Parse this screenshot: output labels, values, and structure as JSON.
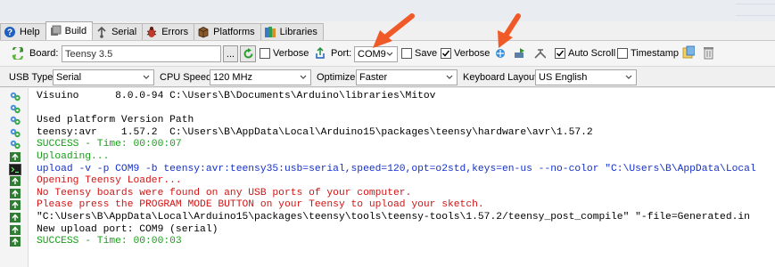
{
  "tabs": [
    {
      "label": "Help",
      "icon": "help-icon"
    },
    {
      "label": "Build",
      "icon": "build-icon"
    },
    {
      "label": "Serial",
      "icon": "serial-icon"
    },
    {
      "label": "Errors",
      "icon": "bug-icon"
    },
    {
      "label": "Platforms",
      "icon": "platforms-icon"
    },
    {
      "label": "Libraries",
      "icon": "libraries-icon"
    }
  ],
  "active_tab": "Build",
  "toolbar": {
    "board_label": "Board:",
    "board_value": "Teensy 3.5",
    "browse_label": "...",
    "verbose_label_1": "Verbose",
    "port_label": "Port:",
    "port_value": "COM9",
    "save_label": "Save",
    "verbose_label_2": "Verbose",
    "verbose_2_checked": true,
    "autoscroll_label": "Auto Scroll",
    "autoscroll_checked": true,
    "timestamp_label": "Timestamp"
  },
  "options": {
    "usb_type_label": "USB Type:",
    "usb_type_value": "Serial",
    "cpu_speed_label": "CPU Speed:",
    "cpu_speed_value": "120 MHz",
    "optimize_label": "Optimize:",
    "optimize_value": "Faster",
    "keyboard_layout_label": "Keyboard Layout:",
    "keyboard_layout_value": "US English"
  },
  "console": {
    "lines": [
      {
        "text": "Visuino      8.0.0-94 C:\\Users\\B\\Documents\\Arduino\\libraries\\Mitov",
        "color": "#000000",
        "icon": "info"
      },
      {
        "text": "",
        "color": "#000000",
        "icon": "info"
      },
      {
        "text": "Used platform Version Path",
        "color": "#000000",
        "icon": "info"
      },
      {
        "text": "teensy:avr    1.57.2  C:\\Users\\B\\AppData\\Local\\Arduino15\\packages\\teensy\\hardware\\avr\\1.57.2",
        "color": "#000000",
        "icon": "info"
      },
      {
        "text": "SUCCESS - Time: 00:00:07",
        "color": "#1a9e1a",
        "icon": "info"
      },
      {
        "text": "Uploading...",
        "color": "#1a9e1a",
        "icon": "upload"
      },
      {
        "text": "upload -v -p COM9 -b teensy:avr:teensy35:usb=serial,speed=120,opt=o2std,keys=en-us --no-color \"C:\\Users\\B\\AppData\\Local",
        "color": "#1530c8",
        "icon": "terminal"
      },
      {
        "text": "Opening Teensy Loader...",
        "color": "#d21414",
        "icon": "upload"
      },
      {
        "text": "No Teensy boards were found on any USB ports of your computer.",
        "color": "#d21414",
        "icon": "upload"
      },
      {
        "text": "Please press the PROGRAM MODE BUTTON on your Teensy to upload your sketch.",
        "color": "#d21414",
        "icon": "upload"
      },
      {
        "text": "\"C:\\Users\\B\\AppData\\Local\\Arduino15\\packages\\teensy\\tools\\teensy-tools\\1.57.2/teensy_post_compile\" \"-file=Generated.in",
        "color": "#000000",
        "icon": "upload"
      },
      {
        "text": "New upload port: COM9 (serial)",
        "color": "#000000",
        "icon": "upload"
      },
      {
        "text": "SUCCESS - Time: 00:00:03",
        "color": "#1a9e1a",
        "icon": "upload"
      }
    ]
  },
  "colors": {
    "annotation_arrow": "#f05a28",
    "success": "#1a9e1a",
    "error": "#d21414",
    "command": "#1530c8"
  }
}
